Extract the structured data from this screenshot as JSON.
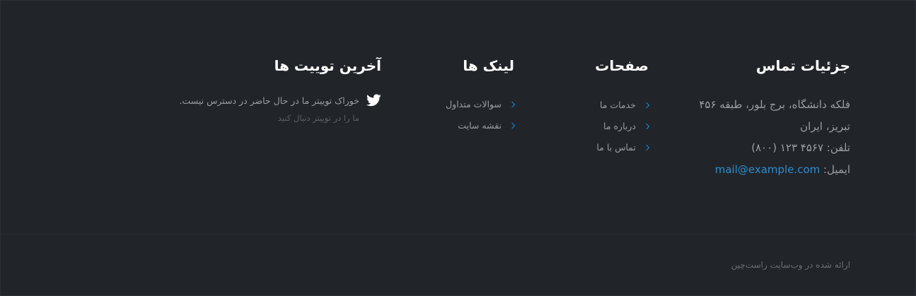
{
  "contact": {
    "title": "جزئیات تماس",
    "address_line1": "فلکه دانشگاه، برج بلور، طبقه ۴۵۶",
    "address_line2": "تبریز، ایران",
    "phone": "تلفن: ۴۵۶۷ ۱۲۳ (۸۰۰)",
    "email_label": "ایمیل: ",
    "email": "mail@example.com"
  },
  "pages": {
    "title": "صفحات",
    "items": [
      {
        "label": "خدمات ما"
      },
      {
        "label": "درباره ما"
      },
      {
        "label": "تماس با ما"
      }
    ]
  },
  "links": {
    "title": "لینک ها",
    "items": [
      {
        "label": "سوالات متداول"
      },
      {
        "label": "نقشه سایت"
      }
    ]
  },
  "tweets": {
    "title": "آخرین توییت ها",
    "icon": "twitter-icon",
    "feed_message": "خوراک توییتر ما در حال حاضر در دسترس نیست.",
    "follow_text": "ما را در توییتر دنبال کنید"
  },
  "footer": {
    "copyright": "ارائه شده در وب‌سایت راست‌چین"
  },
  "colors": {
    "background": "#212429",
    "accent": "#2f8ed0",
    "text": "#9a9ea5",
    "heading": "#ffffff"
  }
}
